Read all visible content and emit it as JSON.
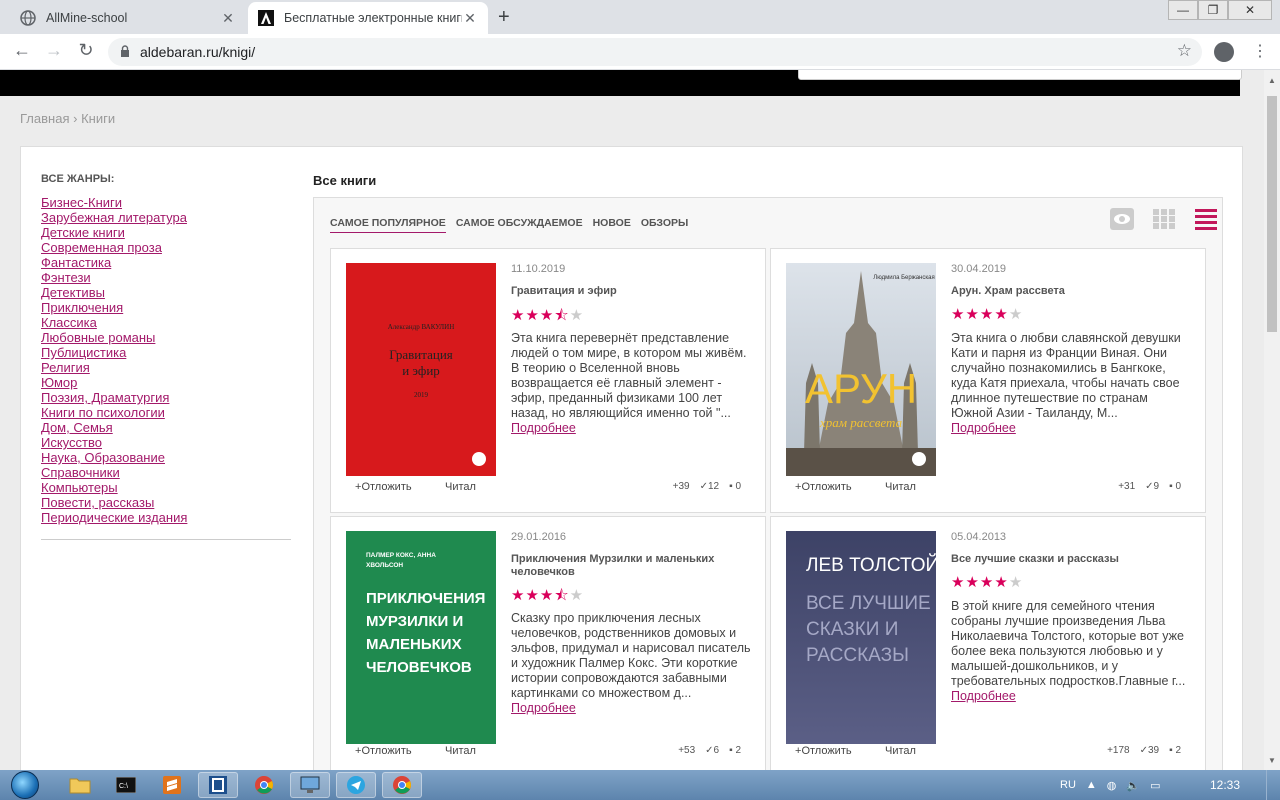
{
  "browser": {
    "tabs": [
      {
        "title": "AllMine-school",
        "active": false
      },
      {
        "title": "Бесплатные электронные книги",
        "active": true
      }
    ],
    "url": "aldebaran.ru/knigi/"
  },
  "breadcrumb": {
    "home": "Главная",
    "separator": "›",
    "current": "Книги"
  },
  "sidebar": {
    "title": "ВСЕ ЖАНРЫ:",
    "genres": [
      "Бизнес-Книги",
      "Зарубежная литература",
      "Детские книги",
      "Современная проза",
      "Фантастика",
      "Фэнтези",
      "Детективы",
      "Приключения",
      "Классика",
      "Любовные романы",
      "Публицистика",
      "Религия",
      "Юмор",
      "Поэзия, Драматургия",
      "Книги по психологии",
      "Дом, Семья",
      "Искусство",
      "Наука, Образование",
      "Справочники",
      "Компьютеры",
      "Повести, рассказы",
      "Периодические издания"
    ]
  },
  "main": {
    "title": "Все книги",
    "sorts": [
      "САМОЕ ПОПУЛЯРНОЕ",
      "САМОЕ ОБСУЖДАЕМОЕ",
      "НОВОЕ",
      "ОБЗОРЫ"
    ],
    "active_sort": "САМОЕ ПОПУЛЯРНОЕ"
  },
  "books": [
    {
      "date": "11.10.2019",
      "title": "Гравитация и эфир",
      "rating": 3.5,
      "description": "Эта книга перевернёт представление людей о том мире, в котором мы живём. В теорию о Вселенной вновь возвращается её главный элемент - эфир, преданный физиками 100 лет назад, но являющийся именно той \"...",
      "more": "Подробнее",
      "postpone": "Отложить",
      "read": "Читал",
      "stats": {
        "plus": "39",
        "read": "12",
        "comments": "0"
      },
      "cover": {
        "author": "Александр ВАКУЛИН",
        "title": "Гравитация и эфир",
        "year": "2019",
        "bg": "#d7191c"
      }
    },
    {
      "date": "30.04.2019",
      "title": "Арун. Храм рассвета",
      "rating": 4,
      "description": "Эта книга о любви славянской девушки Кати и парня из Франции Виная. Они случайно познакомились в Бангкоке, куда Катя приехала, чтобы начать свое длинное путешествие по странам Южной Азии - Таиланду, М...",
      "more": "Подробнее",
      "postpone": "Отложить",
      "read": "Читал",
      "stats": {
        "plus": "31",
        "read": "9",
        "comments": "0"
      },
      "cover": {
        "author": "Людмила Бержанская",
        "title": "АРУН",
        "subtitle": "храм рассвета"
      }
    },
    {
      "date": "29.01.2016",
      "title": "Приключения Мурзилки и маленьких человечков",
      "rating": 3.5,
      "description": "Сказку про приключения лесных человечков, родственников домовых и эльфов, придумал и нарисовал писатель и художник Палмер Кокс. Эти короткие истории сопровождаются забавными картинками со множеством д...",
      "more": "Подробнее",
      "postpone": "Отложить",
      "read": "Читал",
      "stats": {
        "plus": "53",
        "read": "6",
        "comments": "2"
      },
      "cover": {
        "author": "ПАЛМЕР КОКС, АННА ХВОЛЬСОН",
        "title": "ПРИКЛЮЧЕНИЯ МУРЗИЛКИ И МАЛЕНЬКИХ ЧЕЛОВЕЧКОВ",
        "bg": "#1f8a4f"
      }
    },
    {
      "date": "05.04.2013",
      "title": "Все лучшие сказки и рассказы",
      "rating": 4,
      "description": "В этой книге для семейного чтения собраны лучшие произведения Льва Николаевича Толстого, которые вот уже более века пользуются любовью и у малышей-дошкольников, и у требовательных подростков.Главные г...",
      "more": "Подробнее",
      "postpone": "Отложить",
      "read": "Читал",
      "stats": {
        "plus": "178",
        "read": "39",
        "comments": "2"
      },
      "cover": {
        "author": "ЛЕВ ТОЛСТОЙ",
        "title": "ВСЕ ЛУЧШИЕ СКАЗКИ И РАССКАЗЫ",
        "bg": "#4a4e74"
      }
    }
  ],
  "taskbar": {
    "lang": "RU",
    "time": "12:33"
  },
  "colors": {
    "accent": "#a3196a",
    "star": "#d9005b"
  }
}
